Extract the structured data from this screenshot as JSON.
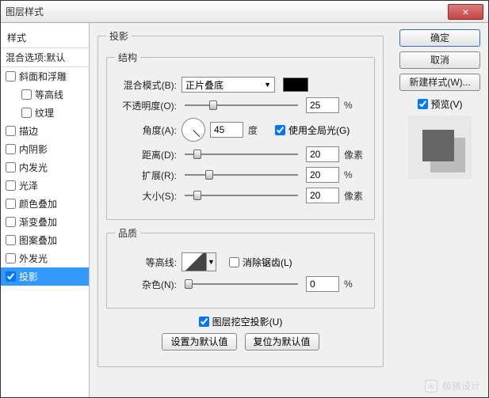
{
  "title": "图层样式",
  "sidebar": {
    "header": "样式",
    "blend": "混合选项:默认",
    "items": [
      {
        "label": "斜面和浮雕"
      },
      {
        "label": "等高线",
        "sub": true
      },
      {
        "label": "纹理",
        "sub": true
      },
      {
        "label": "描边"
      },
      {
        "label": "内阴影"
      },
      {
        "label": "内发光"
      },
      {
        "label": "光泽"
      },
      {
        "label": "颜色叠加"
      },
      {
        "label": "渐变叠加"
      },
      {
        "label": "图案叠加"
      },
      {
        "label": "外发光"
      },
      {
        "label": "投影",
        "checked": true,
        "selected": true
      }
    ]
  },
  "panel": {
    "title": "投影",
    "struct": {
      "legend": "结构",
      "blend_label": "混合模式(B):",
      "blend_value": "正片叠底",
      "opacity_label": "不透明度(O):",
      "opacity_value": "25",
      "pct": "%",
      "angle_label": "角度(A):",
      "angle_value": "45",
      "angle_unit": "度",
      "global_label": "使用全局光(G)",
      "distance_label": "距离(D):",
      "distance_value": "20",
      "px": "像素",
      "spread_label": "扩展(R):",
      "spread_value": "20",
      "size_label": "大小(S):",
      "size_value": "20"
    },
    "quality": {
      "legend": "品质",
      "contour_label": "等高线:",
      "antialias_label": "消除锯齿(L)",
      "noise_label": "杂色(N):",
      "noise_value": "0"
    },
    "knockout_label": "图层挖空投影(U)",
    "set_default": "设置为默认值",
    "reset_default": "复位为默认值"
  },
  "buttons": {
    "ok": "确定",
    "cancel": "取消",
    "newstyle": "新建样式(W)...",
    "preview": "预览(V)"
  },
  "watermark": "极微设计"
}
